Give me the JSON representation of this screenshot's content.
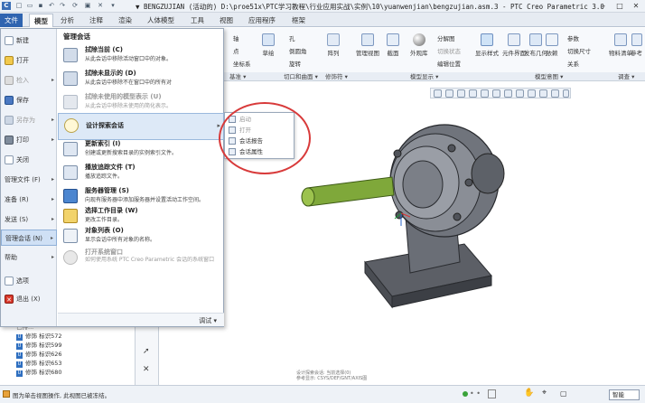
{
  "window": {
    "title": "▼ BENGZUJIAN (活动的) D:\\proe51x\\PTC学习教程\\行业应用实战\\实例\\10\\yuanwenjian\\bengzujian.asm.3 - PTC Creo Parametric 3.0"
  },
  "tabs": [
    {
      "label": "文件"
    },
    {
      "label": "模型"
    },
    {
      "label": "分析"
    },
    {
      "label": "注释"
    },
    {
      "label": "渲染"
    },
    {
      "label": "人体模型"
    },
    {
      "label": "工具"
    },
    {
      "label": "视图"
    },
    {
      "label": "应用程序"
    },
    {
      "label": "框架"
    }
  ],
  "ribbon": {
    "btn_axis": "轴",
    "btn_point": "点",
    "btn_coordsys": "坐标系",
    "btn_sketch": "草绘",
    "btn_hole": "孔",
    "btn_round": "倒圆角",
    "btn_rotate": "旋转",
    "btn_pattern": "阵列",
    "btn_manage_view": "管理视图",
    "btn_section": "截面",
    "btn_appearance": "外观库",
    "btn_explode": "分解图",
    "btn_toggle_state": "切换状态",
    "btn_edit_pos": "编辑位置",
    "btn_display_style": "显示样式",
    "btn_component_list": "元件界面",
    "btn_publish_geom": "发布几何",
    "btn_dependency": "依赖",
    "btn_params": "参数",
    "btn_switch_size": "切换尺寸",
    "btn_relations": "关系",
    "btn_bom": "物料清单",
    "btn_more": "参考",
    "groups": {
      "datum": "基准 ▾",
      "cut_surface": "切口和曲面 ▾",
      "modifiers": "修饰符 ▾",
      "model_display": "模型显示 ▾",
      "model_intent": "模型意图 ▾",
      "investigate": "调查 ▾"
    }
  },
  "file_menu": {
    "left_items": [
      {
        "label": "新建"
      },
      {
        "label": "打开"
      },
      {
        "label": "检入"
      },
      {
        "label": "保存"
      },
      {
        "label": "另存为"
      },
      {
        "label": "打印"
      },
      {
        "label": "关闭"
      },
      {
        "label": "管理文件 (F)"
      },
      {
        "label": "准备 (R)"
      },
      {
        "label": "发送 (S)"
      },
      {
        "label": "管理会话 (N)"
      },
      {
        "label": "帮助"
      },
      {
        "label": "选项"
      },
      {
        "label": "退出 (X)"
      }
    ],
    "right_title": "管理会话",
    "right_items": [
      {
        "title": "拭除当前 (C)",
        "desc": "从此会话中移除活动窗口中的对象。"
      },
      {
        "title": "拭除未显示的 (D)",
        "desc": "从此会话中移除不在窗口中的所有对"
      },
      {
        "title": "拭除未使用的模型表示 (U)",
        "desc": "从此会话中移除未使用的简化表示。"
      },
      {
        "title": "设计探索会话",
        "desc": ""
      },
      {
        "title": "更新索引 (I)",
        "desc": "创建或更新搜索目录的实例索引文件。"
      },
      {
        "title": "播放追踪文件 (T)",
        "desc": "播放追踪文件。"
      },
      {
        "title": "服务器管理 (S)",
        "desc": "向现有服务器中添加服务器并设置活动工作空间。"
      },
      {
        "title": "选择工作目录 (W)",
        "desc": "更改工作目录。"
      },
      {
        "title": "对象列表 (O)",
        "desc": "显示会话中所有对象的名称。"
      },
      {
        "title": "打开系统窗口",
        "desc": "如何使用系统 PTC Creo Parametric 会话的系统窗口"
      }
    ],
    "tail_label": "调试 ▾"
  },
  "submenu": {
    "items": [
      {
        "label": "启动"
      },
      {
        "label": "打开"
      },
      {
        "label": "会话报告"
      },
      {
        "label": "会话属性"
      }
    ]
  },
  "model_tree": {
    "rows": [
      {
        "label": "修饰 标识572"
      },
      {
        "label": "修饰 标识599"
      },
      {
        "label": "修饰 标识626"
      },
      {
        "label": "修饰 标识653"
      },
      {
        "label": "修饰 标识680"
      }
    ],
    "cut_row": "已排..."
  },
  "graphics": {
    "corner_note_1": "设计探索会话: 当前选择(0)",
    "corner_note_2": "参考显示: CSYS/DEF/GNT/AXIS图"
  },
  "status": {
    "message": "图为单击视图操作, 此视图已被冻结。",
    "filter": "智能"
  }
}
